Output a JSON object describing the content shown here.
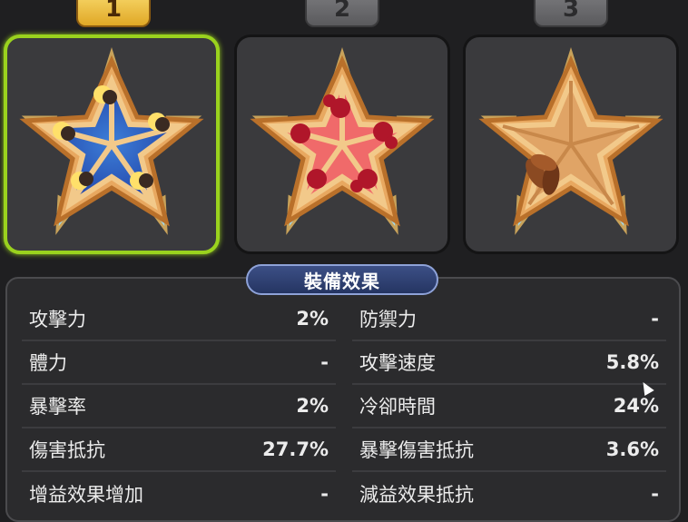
{
  "tabs": [
    {
      "label": "1",
      "active": true
    },
    {
      "label": "2",
      "active": false
    },
    {
      "label": "3",
      "active": false
    }
  ],
  "slots": [
    {
      "name": "starry-moon-jelly-tart",
      "selected": true
    },
    {
      "name": "raspberry-jelly-tart",
      "selected": false
    },
    {
      "name": "empty-tart-with-almond",
      "selected": false
    }
  ],
  "panel": {
    "title": "裝備效果",
    "left_stats": [
      {
        "label": "攻擊力",
        "value": "2%"
      },
      {
        "label": "體力",
        "value": "-"
      },
      {
        "label": "暴擊率",
        "value": "2%"
      },
      {
        "label": "傷害抵抗",
        "value": "27.7%"
      },
      {
        "label": "增益效果增加",
        "value": "-"
      }
    ],
    "right_stats": [
      {
        "label": "防禦力",
        "value": "-"
      },
      {
        "label": "攻擊速度",
        "value": "5.8%"
      },
      {
        "label": "冷卻時間",
        "value": "24%"
      },
      {
        "label": "暴擊傷害抵抗",
        "value": "3.6%"
      },
      {
        "label": "減益效果抵抗",
        "value": "-"
      }
    ]
  },
  "colors": {
    "selected_border": "#9ad21e",
    "title_bg": "#2f4170",
    "tab_active": "#f0c040"
  }
}
